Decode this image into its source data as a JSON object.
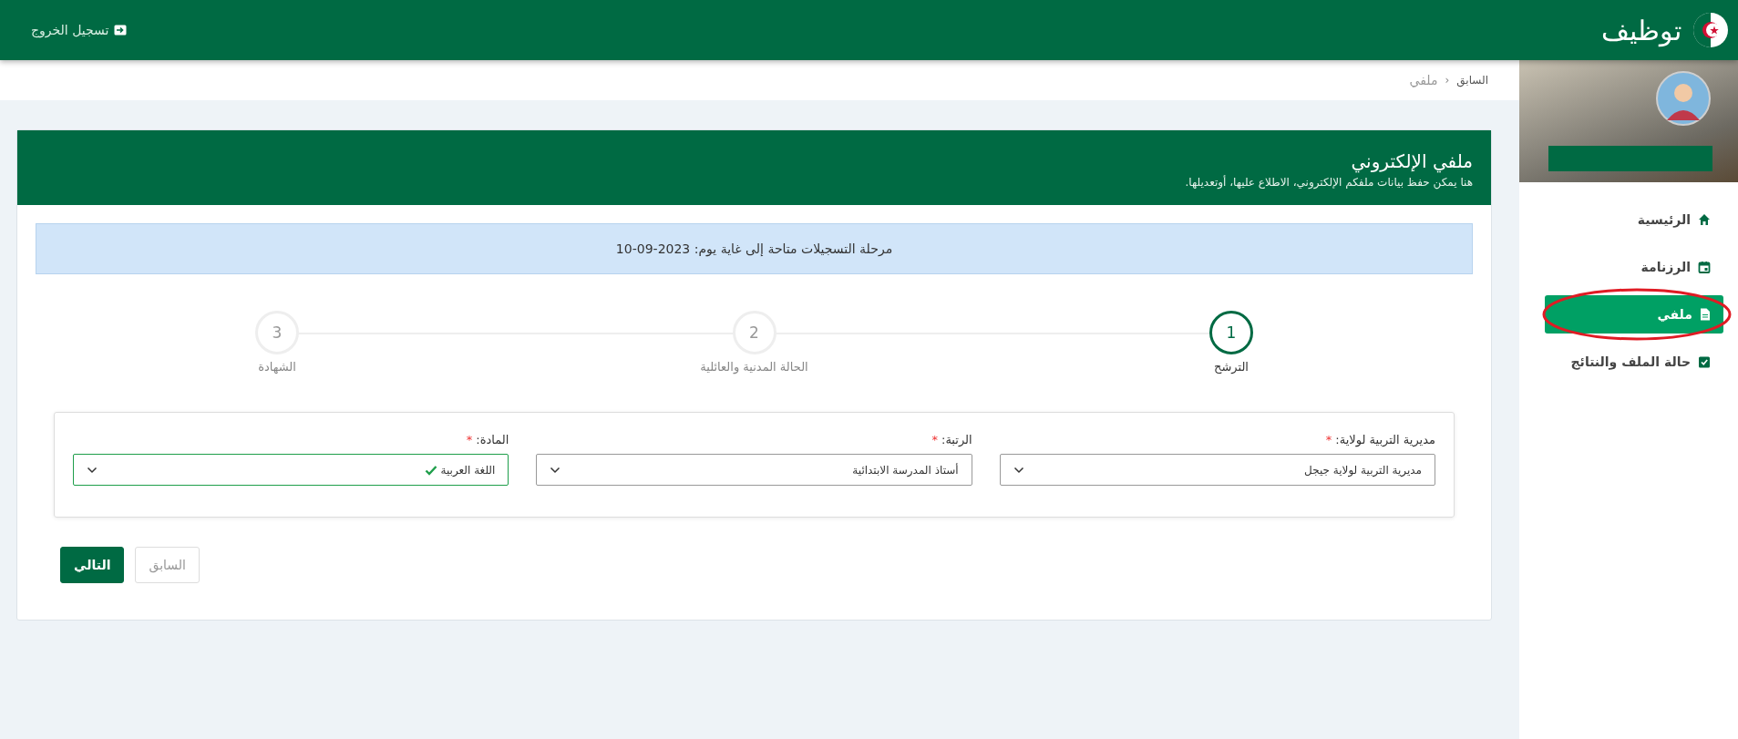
{
  "topbar": {
    "logo_text": "توظيف",
    "logout": "تسجيل الخروج"
  },
  "sidebar": {
    "items": [
      {
        "label": "الرئيسية",
        "kind": "home",
        "selected": false
      },
      {
        "label": "الرزنامة",
        "kind": "calendar",
        "selected": false
      },
      {
        "label": "ملفي",
        "kind": "file",
        "selected": true
      },
      {
        "label": "حالة الملف والنتائج",
        "kind": "check",
        "selected": false
      }
    ]
  },
  "breadcrumb": {
    "back": "السابق",
    "separator": "‹",
    "current": "ملفي"
  },
  "card": {
    "title": "ملفي الإلكتروني",
    "subtitle": "هنا يمكن حفظ بيانات ملفكم الإلكتروني، الاطلاع عليها، أوتعديلها.",
    "notice": "مرحلة التسجيلات متاحة إلى غاية يوم: 2023-09-10"
  },
  "steps": [
    {
      "number": "1",
      "label": "الترشح",
      "selected": true
    },
    {
      "number": "2",
      "label": "الحالة المدنية والعائلية",
      "selected": false
    },
    {
      "number": "3",
      "label": "الشهادة",
      "selected": false
    }
  ],
  "fields": [
    {
      "label": "مديرية التربية لولاية:",
      "required": "*",
      "value": "مديرية التربية لولاية جيجل",
      "valid": false
    },
    {
      "label": "الرتبة:",
      "required": "*",
      "value": "أستاذ المدرسة الابتدائية",
      "valid": false
    },
    {
      "label": "المادة:",
      "required": "*",
      "value": "اللغة العربية",
      "valid": true
    }
  ],
  "buttons": [
    {
      "label": "السابق",
      "kind": "secondary",
      "disabled": true
    },
    {
      "label": "التالي",
      "kind": "primary",
      "disabled": false
    }
  ]
}
